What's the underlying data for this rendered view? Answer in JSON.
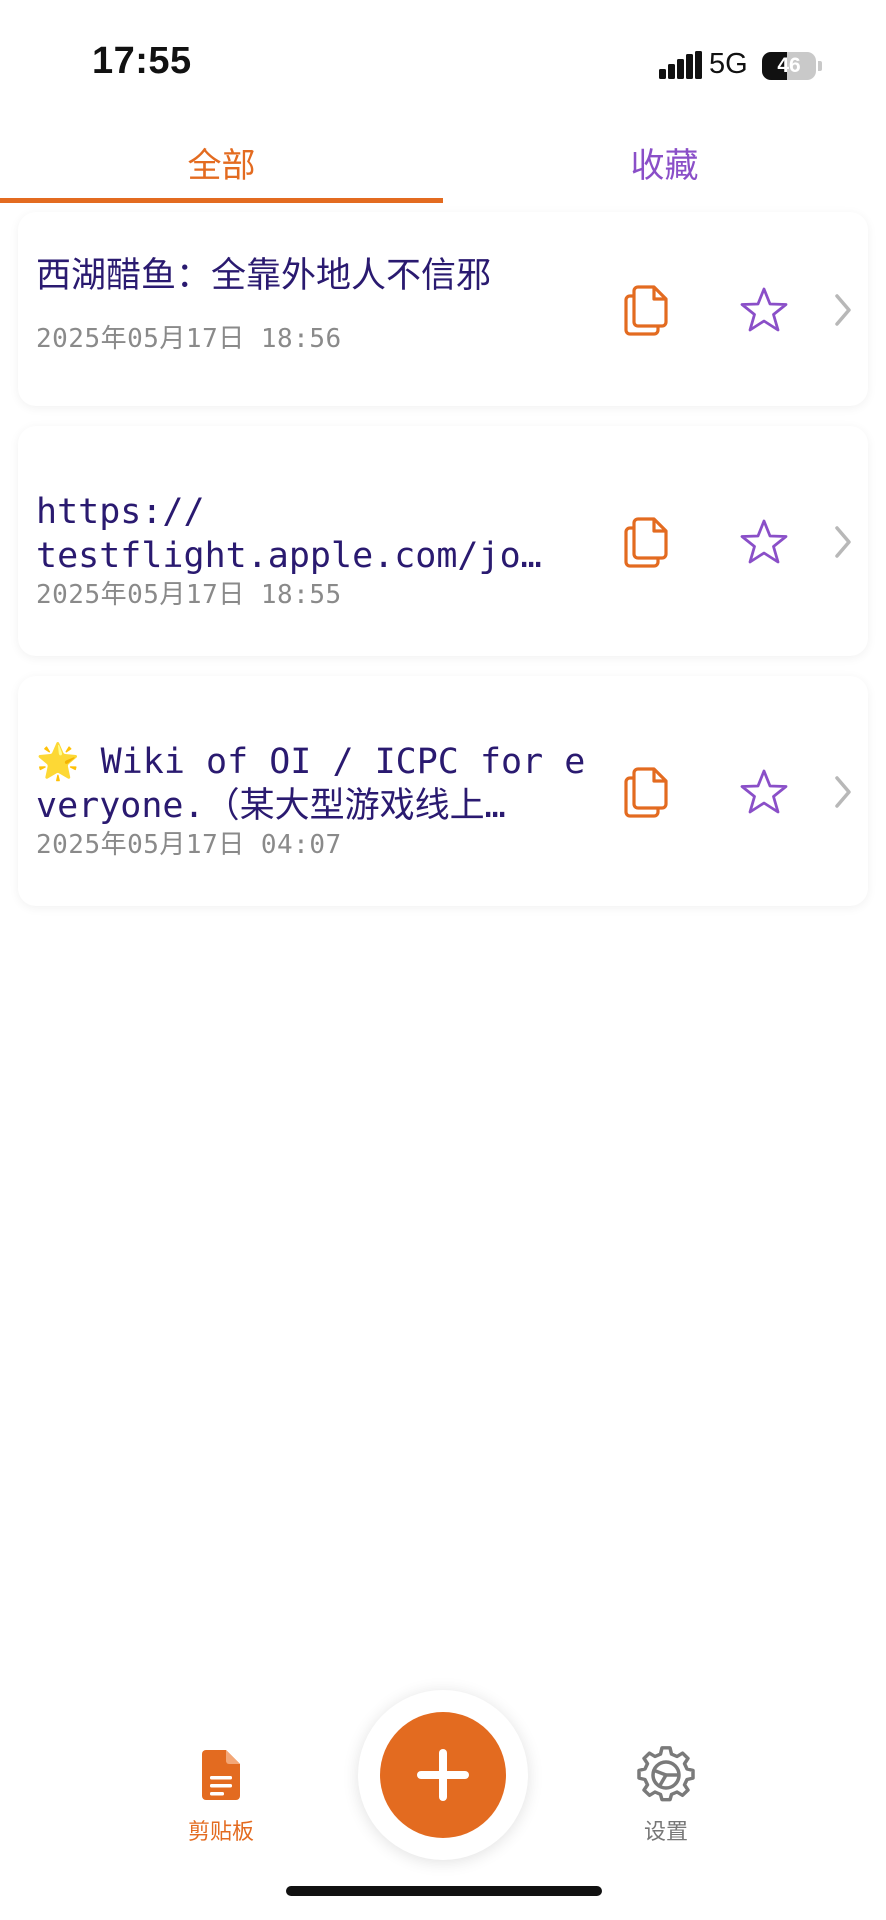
{
  "status_bar": {
    "time": "17:55",
    "network": "5G",
    "battery_level": "46",
    "battery_fraction": 0.46,
    "signal_icon": "cellular-signal-icon"
  },
  "tabs": [
    {
      "label": "全部",
      "selected": true
    },
    {
      "label": "收藏",
      "selected": false
    }
  ],
  "colors": {
    "accent_orange": "#e36b20",
    "accent_purple": "#8a4fc8",
    "text_dark_indigo": "#2a1a70",
    "timestamp_gray": "#8a8a8a"
  },
  "clips": [
    {
      "text": "西湖醋鱼：全靠外地人不信邪",
      "timestamp": "2025年05月17日 18:56",
      "favorited": false
    },
    {
      "text": "https://\ntestflight.apple.com/jo…",
      "timestamp": "2025年05月17日 18:55",
      "favorited": false
    },
    {
      "text": "🌟 Wiki of OI / ICPC for everyone.（某大型游戏线上…",
      "timestamp": "2025年05月17日 04:07",
      "favorited": false
    }
  ],
  "bottom_nav": {
    "clipboard_label": "剪贴板",
    "settings_label": "设置",
    "clipboard_icon": "document-icon",
    "settings_icon": "gear-icon",
    "add_icon": "plus-icon"
  }
}
